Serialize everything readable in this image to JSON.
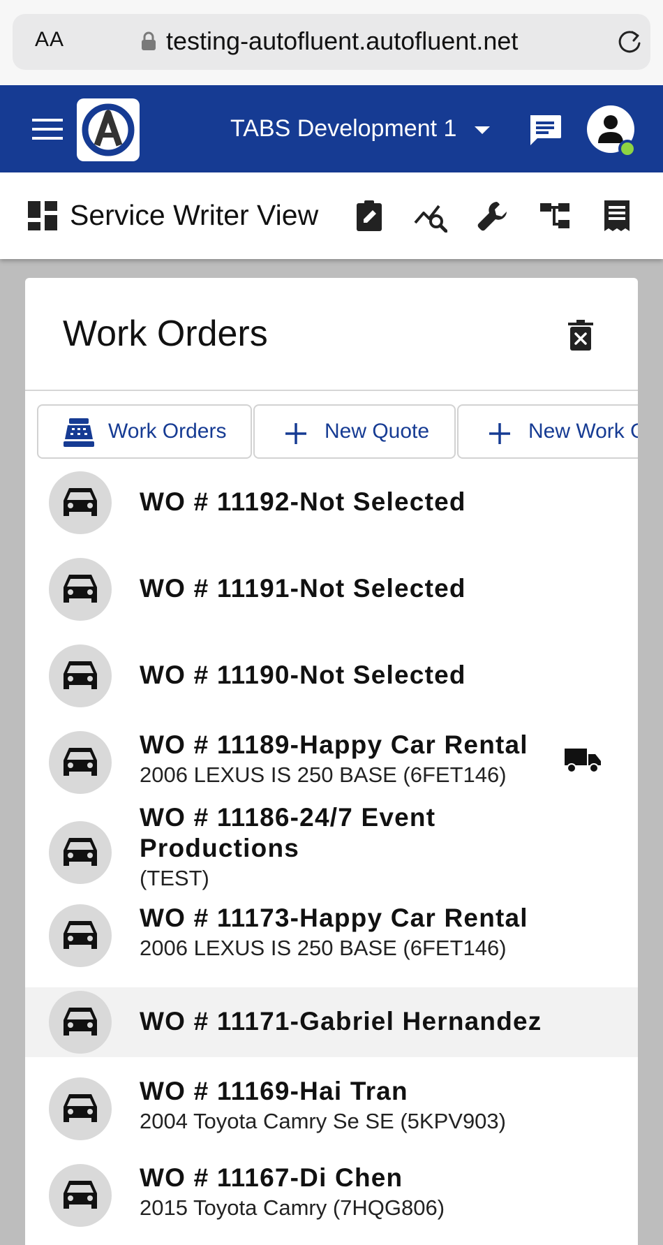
{
  "browser": {
    "text_size_label": "AA",
    "url": "testing-autofluent.autofluent.net"
  },
  "header": {
    "company": "TABS Development 1",
    "brand_color": "#163b93",
    "status_color": "#8ed443"
  },
  "toolbar": {
    "title": "Service Writer View",
    "icons": [
      "clipboard-edit-icon",
      "analytics-search-icon",
      "wrench-icon",
      "hierarchy-icon",
      "receipt-icon"
    ]
  },
  "panel": {
    "title": "Work Orders",
    "tabs": [
      {
        "label": "Work Orders",
        "icon": "register-icon"
      },
      {
        "label": "New Quote",
        "icon": "plus-icon"
      },
      {
        "label": "New Work Order",
        "icon": "plus-icon"
      }
    ]
  },
  "work_orders": [
    {
      "title": "WO # 11192-Not Selected",
      "subtitle": "",
      "highlight": false,
      "truck": false
    },
    {
      "title": "WO # 11191-Not Selected",
      "subtitle": "",
      "highlight": false,
      "truck": false
    },
    {
      "title": "WO # 11190-Not Selected",
      "subtitle": "",
      "highlight": false,
      "truck": false
    },
    {
      "title": "WO # 11189-Happy Car Rental",
      "subtitle": "2006 LEXUS IS 250 BASE (6FET146)",
      "highlight": false,
      "truck": true
    },
    {
      "title": "WO # 11186-24/7 Event",
      "title_line2": "Productions",
      "subtitle": "(TEST)",
      "highlight": false,
      "truck": false
    },
    {
      "title": "WO # 11173-Happy Car Rental",
      "subtitle": "2006 LEXUS IS 250 BASE (6FET146)",
      "highlight": false,
      "truck": false
    },
    {
      "title": "WO # 11171-Gabriel Hernandez",
      "subtitle": "",
      "highlight": true,
      "truck": false
    },
    {
      "title": "WO # 11169-Hai Tran",
      "subtitle": "2004 Toyota Camry Se SE (5KPV903)",
      "highlight": false,
      "truck": false
    },
    {
      "title": "WO # 11167-Di Chen",
      "subtitle": "2015 Toyota Camry (7HQG806)",
      "highlight": false,
      "truck": false
    }
  ]
}
